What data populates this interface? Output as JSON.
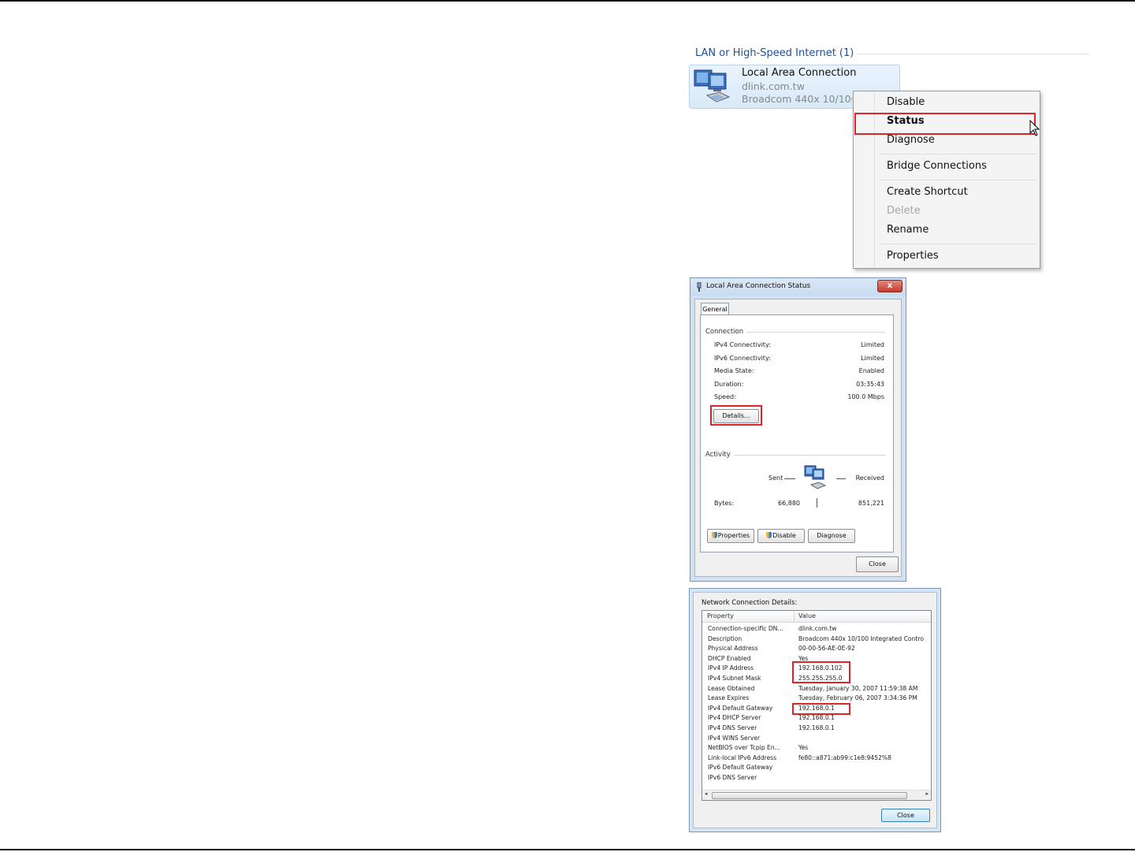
{
  "menu_panel": {
    "group_title": "LAN or High-Speed Internet (1)",
    "connection": {
      "name": "Local Area Connection",
      "network": "dlink.com.tw",
      "adapter": "Broadcom 440x 10/100"
    },
    "context_menu": {
      "items": [
        "Disable",
        "Status",
        "Diagnose",
        "Bridge Connections",
        "Create Shortcut",
        "Delete",
        "Rename",
        "Properties"
      ],
      "highlighted": "Status",
      "disabled": "Delete"
    }
  },
  "status_dialog": {
    "title": "Local Area Connection Status",
    "close_glyph": "x",
    "tab": "General",
    "connection_section": "Connection",
    "connection_rows": [
      {
        "label": "IPv4 Connectivity:",
        "value": "Limited"
      },
      {
        "label": "IPv6 Connectivity:",
        "value": "Limited"
      },
      {
        "label": "Media State:",
        "value": "Enabled"
      },
      {
        "label": "Duration:",
        "value": "03:35:43"
      },
      {
        "label": "Speed:",
        "value": "100.0 Mbps"
      }
    ],
    "details_button": "Details...",
    "activity_section": "Activity",
    "sent_label": "Sent",
    "received_label": "Received",
    "bytes_label": "Bytes:",
    "bytes_sent": "66,880",
    "bytes_received": "851,221",
    "buttons": {
      "properties": "Properties",
      "disable": "Disable",
      "diagnose": "Diagnose",
      "close": "Close"
    }
  },
  "details_dialog": {
    "title": "Network Connection Details:",
    "col_property": "Property",
    "col_value": "Value",
    "rows": [
      {
        "property": "Connection-specific DN...",
        "value": "dlink.com.tw"
      },
      {
        "property": "Description",
        "value": "Broadcom 440x 10/100 Integrated Contro"
      },
      {
        "property": "Physical Address",
        "value": "00-00-56-AE-0E-92"
      },
      {
        "property": "DHCP Enabled",
        "value": "Yes"
      },
      {
        "property": "IPv4 IP Address",
        "value": "192.168.0.102"
      },
      {
        "property": "IPv4 Subnet Mask",
        "value": "255.255.255.0"
      },
      {
        "property": "Lease Obtained",
        "value": "Tuesday, January 30, 2007 11:59:38 AM"
      },
      {
        "property": "Lease Expires",
        "value": "Tuesday, February 06, 2007 3:34:36 PM"
      },
      {
        "property": "IPv4 Default Gateway",
        "value": "192.168.0.1"
      },
      {
        "property": "IPv4 DHCP Server",
        "value": "192.168.0.1"
      },
      {
        "property": "IPv4 DNS Server",
        "value": "192.168.0.1"
      },
      {
        "property": "IPv4 WINS Server",
        "value": ""
      },
      {
        "property": "NetBIOS over Tcpip En...",
        "value": "Yes"
      },
      {
        "property": "Link-local IPv6 Address",
        "value": "fe80::a871:ab99:c1e8:9452%8"
      },
      {
        "property": "IPv6 Default Gateway",
        "value": ""
      },
      {
        "property": "IPv6 DNS Server",
        "value": ""
      }
    ],
    "close_button": "Close"
  },
  "colors": {
    "highlight_box": "#e0232a",
    "group_title": "#1f4f9a"
  }
}
